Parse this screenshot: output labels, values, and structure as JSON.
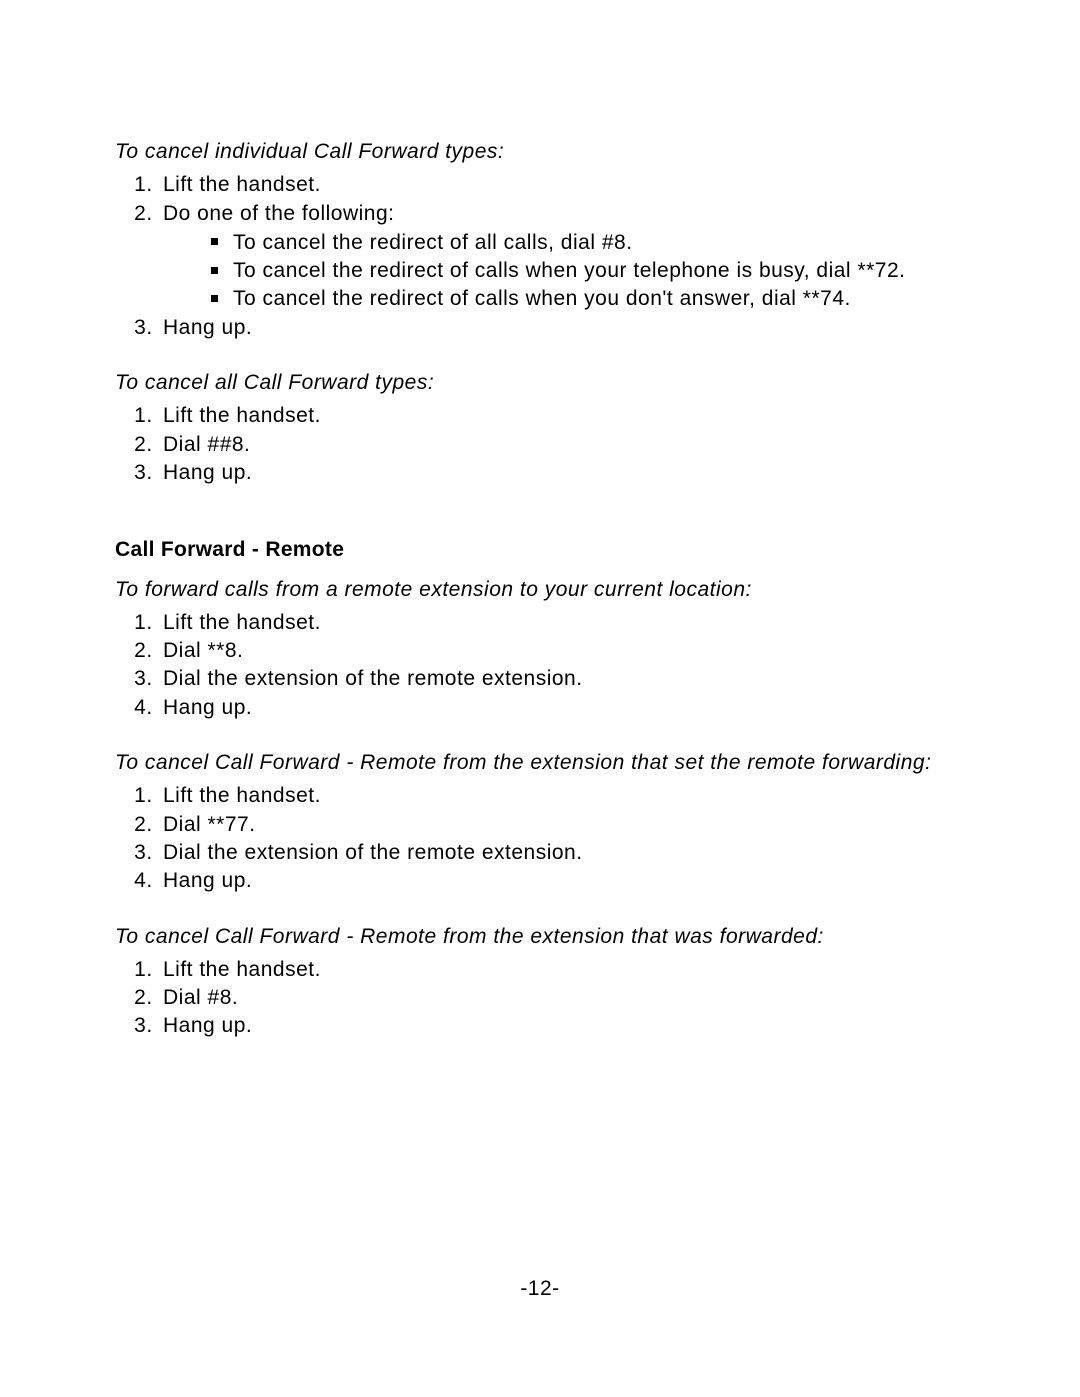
{
  "section1": {
    "heading": "To cancel individual Call Forward types:",
    "steps": [
      "Lift the handset.",
      "Do one of the following:",
      "Hang up."
    ],
    "sub_bullets": [
      "To cancel the redirect of all calls, dial #8.",
      "To cancel the redirect of calls when your telephone is busy, dial **72.",
      "To cancel the redirect of calls when you don't answer, dial **74."
    ]
  },
  "section2": {
    "heading": "To cancel all Call Forward types:",
    "steps": [
      "Lift the handset.",
      "Dial ##8.",
      "Hang up."
    ]
  },
  "bold_heading": "Call Forward - Remote",
  "section3": {
    "heading": "To forward calls from a remote extension to your current location:",
    "steps": [
      "Lift the handset.",
      "Dial **8.",
      "Dial the extension of the remote extension.",
      "Hang up."
    ]
  },
  "section4": {
    "heading": "To cancel Call Forward - Remote from the extension that set the remote forwarding:",
    "steps": [
      "Lift the handset.",
      "Dial **77.",
      "Dial the extension of the remote extension.",
      "Hang up."
    ]
  },
  "section5": {
    "heading": "To cancel Call Forward - Remote from the extension that was forwarded:",
    "steps": [
      "Lift the handset.",
      "Dial #8.",
      "Hang up."
    ]
  },
  "page_number": "-12-"
}
